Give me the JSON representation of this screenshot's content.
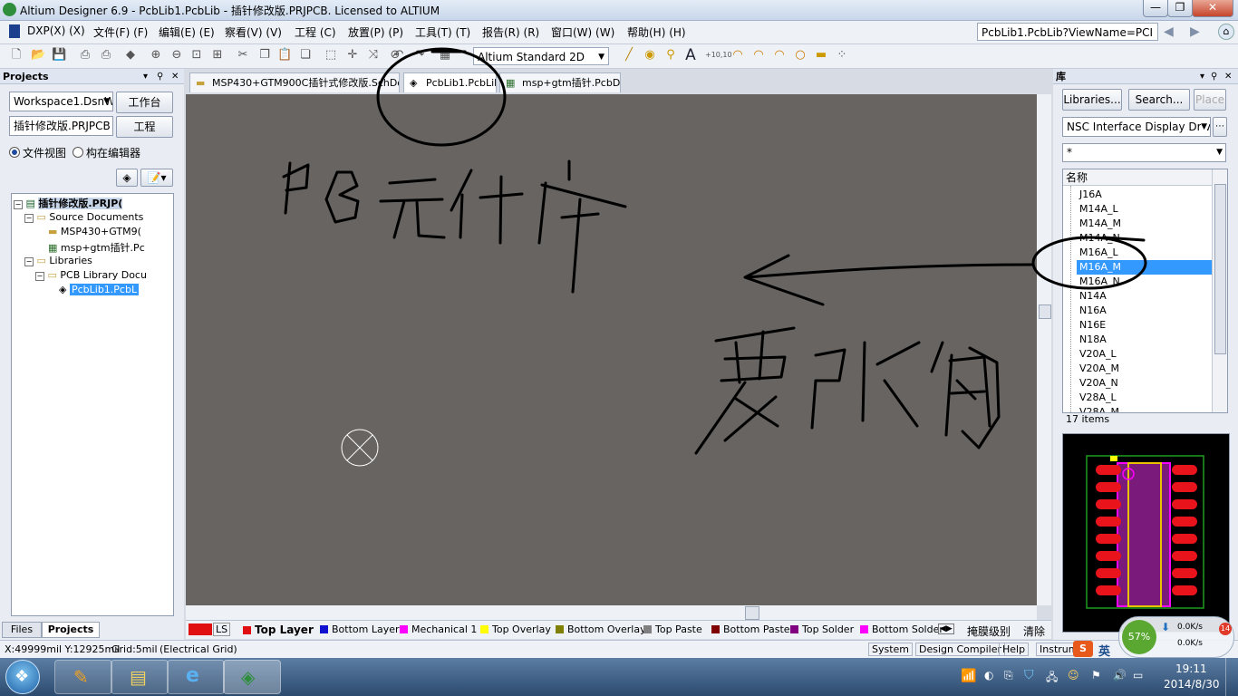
{
  "titlebar": {
    "title": "Altium Designer 6.9 - PcbLib1.PcbLib - 插针修改版.PRJPCB. Licensed to ALTIUM"
  },
  "menubar": {
    "items": [
      "DXP(X) (X)",
      "文件(F) (F)",
      "编辑(E) (E)",
      "察看(V) (V)",
      "工程 (C)",
      "放置(P) (P)",
      "工具(T) (T)",
      "报告(R) (R)",
      "窗口(W) (W)",
      "帮助(H) (H)"
    ],
    "address": "PcbLib1.PcbLib?ViewName=PCI"
  },
  "toolbar": {
    "view_mode": "Altium Standard 2D"
  },
  "projects_panel": {
    "title": "Projects",
    "workspace": "Workspace1.DsnW",
    "workspace_button": "工作台",
    "project": "插针修改版.PRJPCB",
    "project_button": "工程",
    "radio_file_view": "文件视图",
    "radio_struct_editor": "构在编辑器",
    "tree": {
      "project": "插针修改版.PRJP(",
      "source_folder": "Source Documents",
      "source_docs": [
        "MSP430+GTM9(",
        "msp+gtm插针.Pc"
      ],
      "libraries": "Libraries",
      "pcb_lib_folder": "PCB Library Docu",
      "pcb_lib": "PcbLib1.PcbL"
    },
    "bottom_tabs": [
      "Files",
      "Projects"
    ]
  },
  "doc_tabs": [
    "MSP430+GTM900C插针式修改版.SchDoc",
    "PcbLib1.PcbLib",
    "msp+gtm插针.PcbDoc"
  ],
  "layers": {
    "ls_label": "LS",
    "items": [
      {
        "name": "Top Layer",
        "color": "#e01010"
      },
      {
        "name": "Bottom Layer",
        "color": "#1010d0"
      },
      {
        "name": "Mechanical 1",
        "color": "#ff00ff"
      },
      {
        "name": "Top Overlay",
        "color": "#ffff00"
      },
      {
        "name": "Bottom Overlay",
        "color": "#808000"
      },
      {
        "name": "Top Paste",
        "color": "#808080"
      },
      {
        "name": "Bottom Paste",
        "color": "#800000"
      },
      {
        "name": "Top Solder",
        "color": "#800080"
      },
      {
        "name": "Bottom Solder",
        "color": "#ff00ff"
      }
    ],
    "mask_level": "掩膜级别",
    "clear": "清除"
  },
  "library_panel": {
    "title": "库",
    "libraries_button": "Libraries...",
    "search_button": "Search...",
    "place_button": "Place",
    "selected_library": "NSC Interface Display Driver.li",
    "filter": "*",
    "column_header": "名称",
    "items": [
      "J16A",
      "M14A_L",
      "M14A_M",
      "M14A_N",
      "M16A_L",
      "M16A_M",
      "M16A_N",
      "N14A",
      "N16A",
      "N16E",
      "N18A",
      "V20A_L",
      "V20A_M",
      "V20A_N",
      "V28A_L",
      "V28A_M"
    ],
    "selected_item": "M16A_M",
    "count": "17 items"
  },
  "statusbar": {
    "coords": "X:49999mil Y:12925mil",
    "grid": "Grid:5mil",
    "grid_type": "(Electrical Grid)",
    "buttons": [
      "System",
      "Design Compiler",
      "Help",
      "Instrume"
    ]
  },
  "widget": {
    "percent": "57%",
    "speed_down": "0.0K/s",
    "speed_up": "0.0K/s",
    "badge": "14",
    "ime": "英"
  },
  "clock": {
    "time": "19:11",
    "date": "2014/8/30"
  },
  "annotations": {
    "note1": "PCB元件库",
    "note2": "要改的"
  },
  "colors": {
    "canvas": "#676462",
    "selected": "#3399ff",
    "accent": "#1c4d8c"
  }
}
